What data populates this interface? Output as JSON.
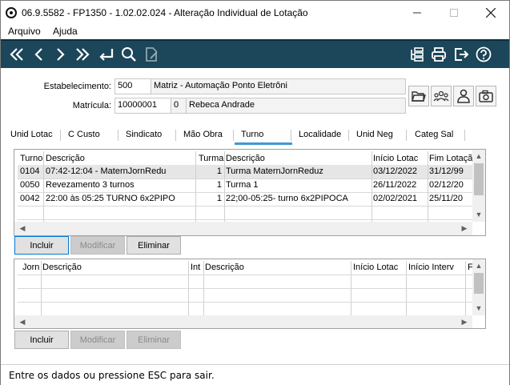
{
  "window": {
    "title": "06.9.5582 - FP1350 - 1.02.02.024 - Alteração Individual de Lotação"
  },
  "menu": {
    "items": [
      "Arquivo",
      "Ajuda"
    ]
  },
  "toolbar": {
    "left_icons": [
      "first-record-icon",
      "previous-record-icon",
      "next-record-icon",
      "last-record-icon",
      "return-icon",
      "search-icon",
      "edit-document-icon"
    ],
    "right_icons": [
      "hierarchy-icon",
      "print-icon",
      "exit-icon",
      "help-icon"
    ]
  },
  "form": {
    "estabelecimento_label": "Estabelecimento:",
    "estabelecimento_code": "500",
    "estabelecimento_name": "Matriz - Automação Ponto Eletrôni",
    "matricula_label": "Matrícula:",
    "matricula_code": "10000001",
    "matricula_digit": "0",
    "matricula_name": "Rebeca Andrade"
  },
  "tabs": [
    "Unid Lotac",
    "C Custo",
    "Sindicato",
    "Mão Obra",
    "Turno",
    "Localidade",
    "Unid Neg",
    "Categ Sal"
  ],
  "active_tab": "Turno",
  "turno_grid": {
    "columns": [
      "Turno",
      "Descrição",
      "Turma",
      "Descrição",
      "Início Lotac",
      "Fim Lotação"
    ],
    "rows": [
      [
        "0104",
        "07:42-12:04 - MaternJornRedu",
        "1",
        "Turma MaternJornReduz",
        "03/12/2022",
        "31/12/99"
      ],
      [
        "0050",
        "Revezamento 3 turnos",
        "1",
        "Turma 1",
        "26/11/2022",
        "02/12/20"
      ],
      [
        "0042",
        "22:00 às 05:25 TURNO 6x2PIPO",
        "1",
        "22;00-05:25-  turno 6x2PIPOCA",
        "02/02/2021",
        "25/11/20"
      ]
    ],
    "selected_row": 0
  },
  "turno_buttons": {
    "incluir": "Incluir",
    "modificar": "Modificar",
    "eliminar": "Eliminar"
  },
  "jornada_grid": {
    "columns": [
      "Jorn",
      "Descrição",
      "Int",
      "Descrição",
      "Início Lotac",
      "Início Interv",
      "F"
    ]
  },
  "jornada_buttons": {
    "incluir": "Incluir",
    "modificar": "Modificar",
    "eliminar": "Eliminar"
  },
  "status": {
    "message": "Entre os dados ou pressione ESC para sair."
  },
  "colors": {
    "toolbar_bg": "#1c4659",
    "tab_active": "#3d9ad1",
    "selected_row": "#e6e6e6"
  }
}
